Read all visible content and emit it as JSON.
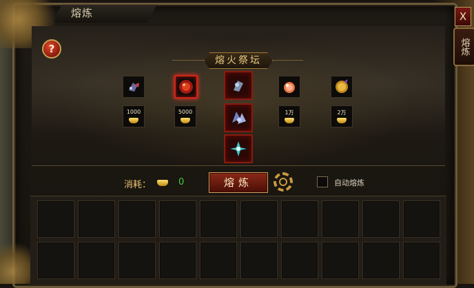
{
  "window": {
    "title": "熔炼",
    "close_label": "X",
    "side_tab_label": "熔炼",
    "help_label": "?"
  },
  "altar": {
    "title": "熔火祭坛",
    "items": [
      {
        "icon": "dark-gem-icon",
        "cost": "1000"
      },
      {
        "icon": "red-orb-icon",
        "cost": "5000",
        "selected": true
      },
      {
        "icon": "orange-crystal-icon",
        "cost": "1万"
      },
      {
        "icon": "gold-coin-icon",
        "cost": "2万"
      }
    ],
    "center_slots": [
      {
        "icon": "blue-ore-icon"
      },
      {
        "icon": "crystal-cluster-icon"
      },
      {
        "icon": "teal-crystal-icon"
      }
    ]
  },
  "footer": {
    "consume_label": "消耗：",
    "consume_value": "0",
    "smelt_button": "熔炼",
    "auto_label": "自动熔炼"
  },
  "inventory": {
    "rows": 2,
    "cols": 10
  },
  "colors": {
    "accent": "#c89a40",
    "highlight": "#d02418",
    "consume_value": "#40d040"
  }
}
